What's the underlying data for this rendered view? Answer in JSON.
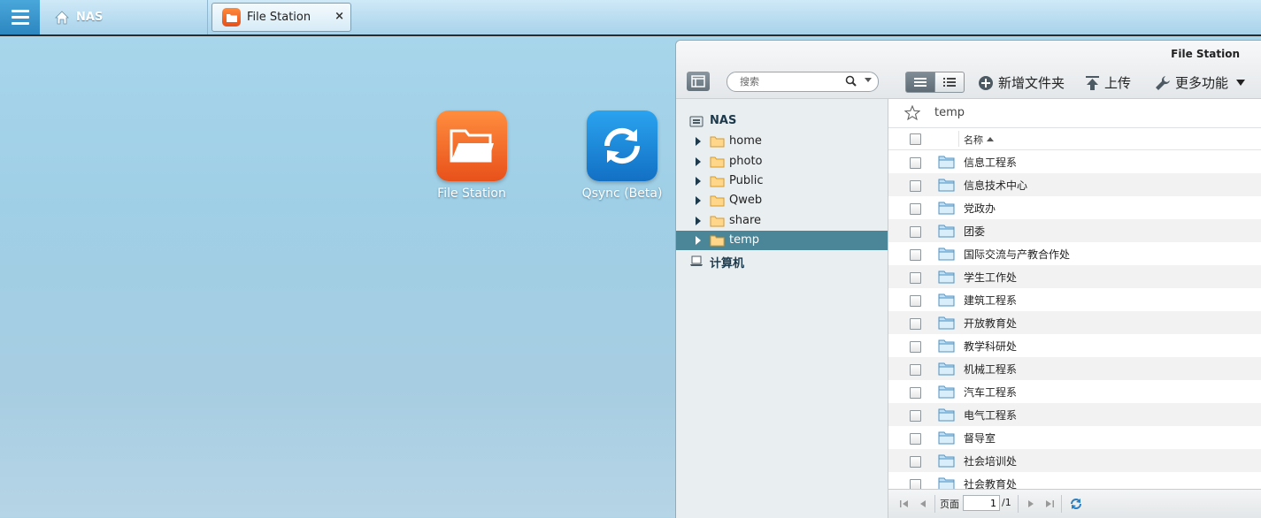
{
  "taskbar": {
    "home_label": "NAS",
    "tab_label": "File Station",
    "tab_close": "×"
  },
  "desktop": {
    "icons": [
      {
        "label": "File Station",
        "icon": "folder-open-icon",
        "color": "#f06a22"
      },
      {
        "label": "Qsync (Beta)",
        "icon": "sync-icon",
        "color": "#1e88d6"
      }
    ]
  },
  "window": {
    "title": "File Station",
    "search_placeholder": "搜索",
    "toolbar": {
      "new_folder": "新增文件夹",
      "upload": "上传",
      "more": "更多功能"
    },
    "tree": {
      "root": "NAS",
      "folders": [
        "home",
        "photo",
        "Public",
        "Qweb",
        "share",
        "temp"
      ],
      "selected": "temp",
      "computer": "计算机"
    },
    "path": "temp",
    "column_name": "名称",
    "files": [
      "信息工程系",
      "信息技术中心",
      "党政办",
      "团委",
      "国际交流与产教合作处",
      "学生工作处",
      "建筑工程系",
      "开放教育处",
      "教学科研处",
      "机械工程系",
      "汽车工程系",
      "电气工程系",
      "督导室",
      "社会培训处",
      "社会教育处"
    ],
    "pager": {
      "page_label": "页面",
      "page_value": "1",
      "total": "/1"
    }
  }
}
